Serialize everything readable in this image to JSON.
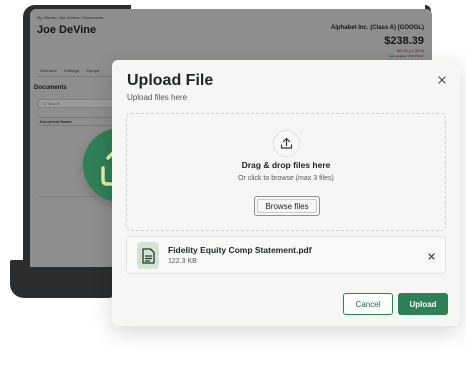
{
  "background_app": {
    "breadcrumb": "My Clients  /  Joe DeVine  /  Documents",
    "client_name": "Joe DeVine",
    "stock_name": "Alphabet Inc. (Class A) (GOOGL)",
    "stock_price": "$238.39",
    "stock_change": "-$3.10 (-1.30%)",
    "last_updated": "Last updated: 3:00 PM ET",
    "tabs": [
      "Overview",
      "Holdings",
      "Compa"
    ],
    "section_title": "Documents",
    "search_placeholder": "Q Search",
    "table_header": "Document Name"
  },
  "dialog": {
    "title": "Upload File",
    "subtitle": "Upload files here",
    "dropzone": {
      "title": "Drag & drop files here",
      "subtitle": "Or click to browse (max 3 files)",
      "browse_label": "Browse files"
    },
    "file": {
      "name": "Fidelity Equity Comp Statement.pdf",
      "size": "122.3 KB"
    },
    "cancel_label": "Cancel",
    "upload_label": "Upload"
  },
  "colors": {
    "accent": "#2f7f57",
    "badge_icon": "#e8f0a0",
    "file_icon_bg": "#d5e4d7"
  },
  "icons": {
    "badge": "upload-arrow-icon",
    "dropzone": "upload-icon",
    "file": "document-icon",
    "close": "close-icon",
    "remove": "remove-file-icon"
  }
}
